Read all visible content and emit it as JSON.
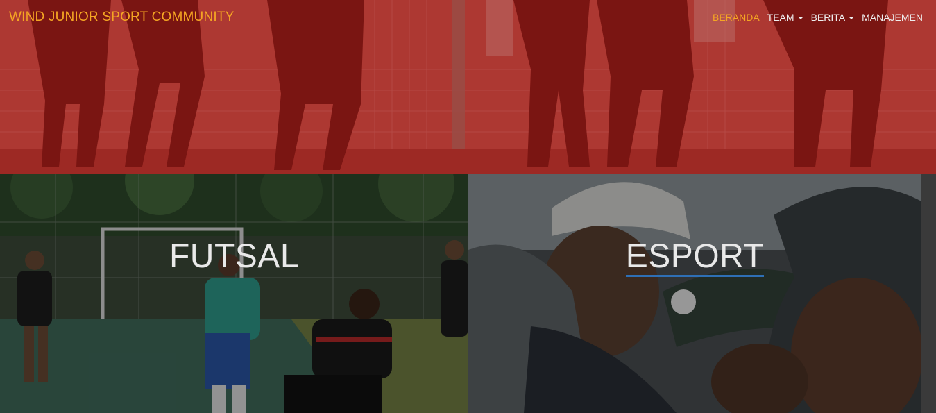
{
  "brand": {
    "name": "WIND JUNIOR SPORT COMMUNITY"
  },
  "nav": {
    "items": [
      {
        "label": "BERANDA",
        "active": true,
        "dropdown": false
      },
      {
        "label": "TEAM",
        "active": false,
        "dropdown": true
      },
      {
        "label": "BERITA",
        "active": false,
        "dropdown": true
      },
      {
        "label": "MANAJEMEN",
        "active": false,
        "dropdown": false
      }
    ]
  },
  "sections": {
    "futsal": {
      "title": "FUTSAL"
    },
    "esport": {
      "title": "ESPORT"
    }
  },
  "colors": {
    "accent": "#f5a623",
    "hero_tint": "#9e2a24",
    "nav_text": "#eeeeee",
    "esport_underline": "#2e6fb5"
  },
  "icons": {
    "dropdown": "caret-down-icon"
  }
}
